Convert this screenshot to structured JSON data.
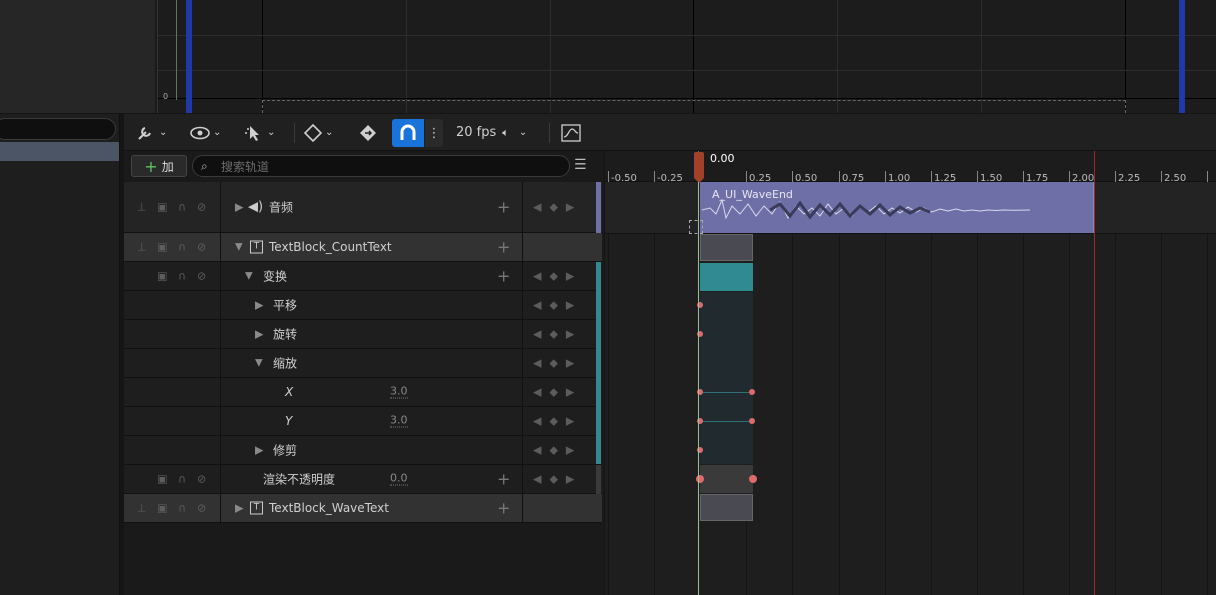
{
  "graph": {
    "zero_label": "0"
  },
  "toolbar": {
    "fps_label": "20 fps",
    "icons": [
      "wrench-icon",
      "eye-icon",
      "cursor-icon",
      "diamond-icon",
      "key-icon",
      "magnet-icon",
      "more-icon",
      "audio-icon",
      "curve-icon"
    ]
  },
  "track_panel": {
    "add_label": "加",
    "search_placeholder": "搜索轨道"
  },
  "tracks": [
    {
      "id": "audio",
      "label": "音频"
    },
    {
      "id": "countText",
      "label": "TextBlock_CountText"
    },
    {
      "id": "transform",
      "label": "变换"
    },
    {
      "id": "translate",
      "label": "平移"
    },
    {
      "id": "rotate",
      "label": "旋转"
    },
    {
      "id": "scale",
      "label": "缩放"
    },
    {
      "id": "scaleX",
      "label": "X",
      "value": "3.0"
    },
    {
      "id": "scaleY",
      "label": "Y",
      "value": "3.0"
    },
    {
      "id": "shear",
      "label": "修剪"
    },
    {
      "id": "opacity",
      "label": "渲染不透明度",
      "value": "0.0"
    },
    {
      "id": "waveText",
      "label": "TextBlock_WaveText"
    }
  ],
  "timeline": {
    "current_time": "0.00",
    "ticks": [
      "-0.50",
      "-0.25",
      "0.25",
      "0.50",
      "0.75",
      "1.00",
      "1.25",
      "1.50",
      "1.75",
      "2.00",
      "2.25",
      "2.50"
    ],
    "audio_clip_name": "A_UI_WaveEnd"
  },
  "colors": {
    "accent": "#1a73d9",
    "audio_clip": "#6f6fa8",
    "teal": "#2f8a91",
    "key": "#e06a6a",
    "playhead": "#a0422a"
  }
}
